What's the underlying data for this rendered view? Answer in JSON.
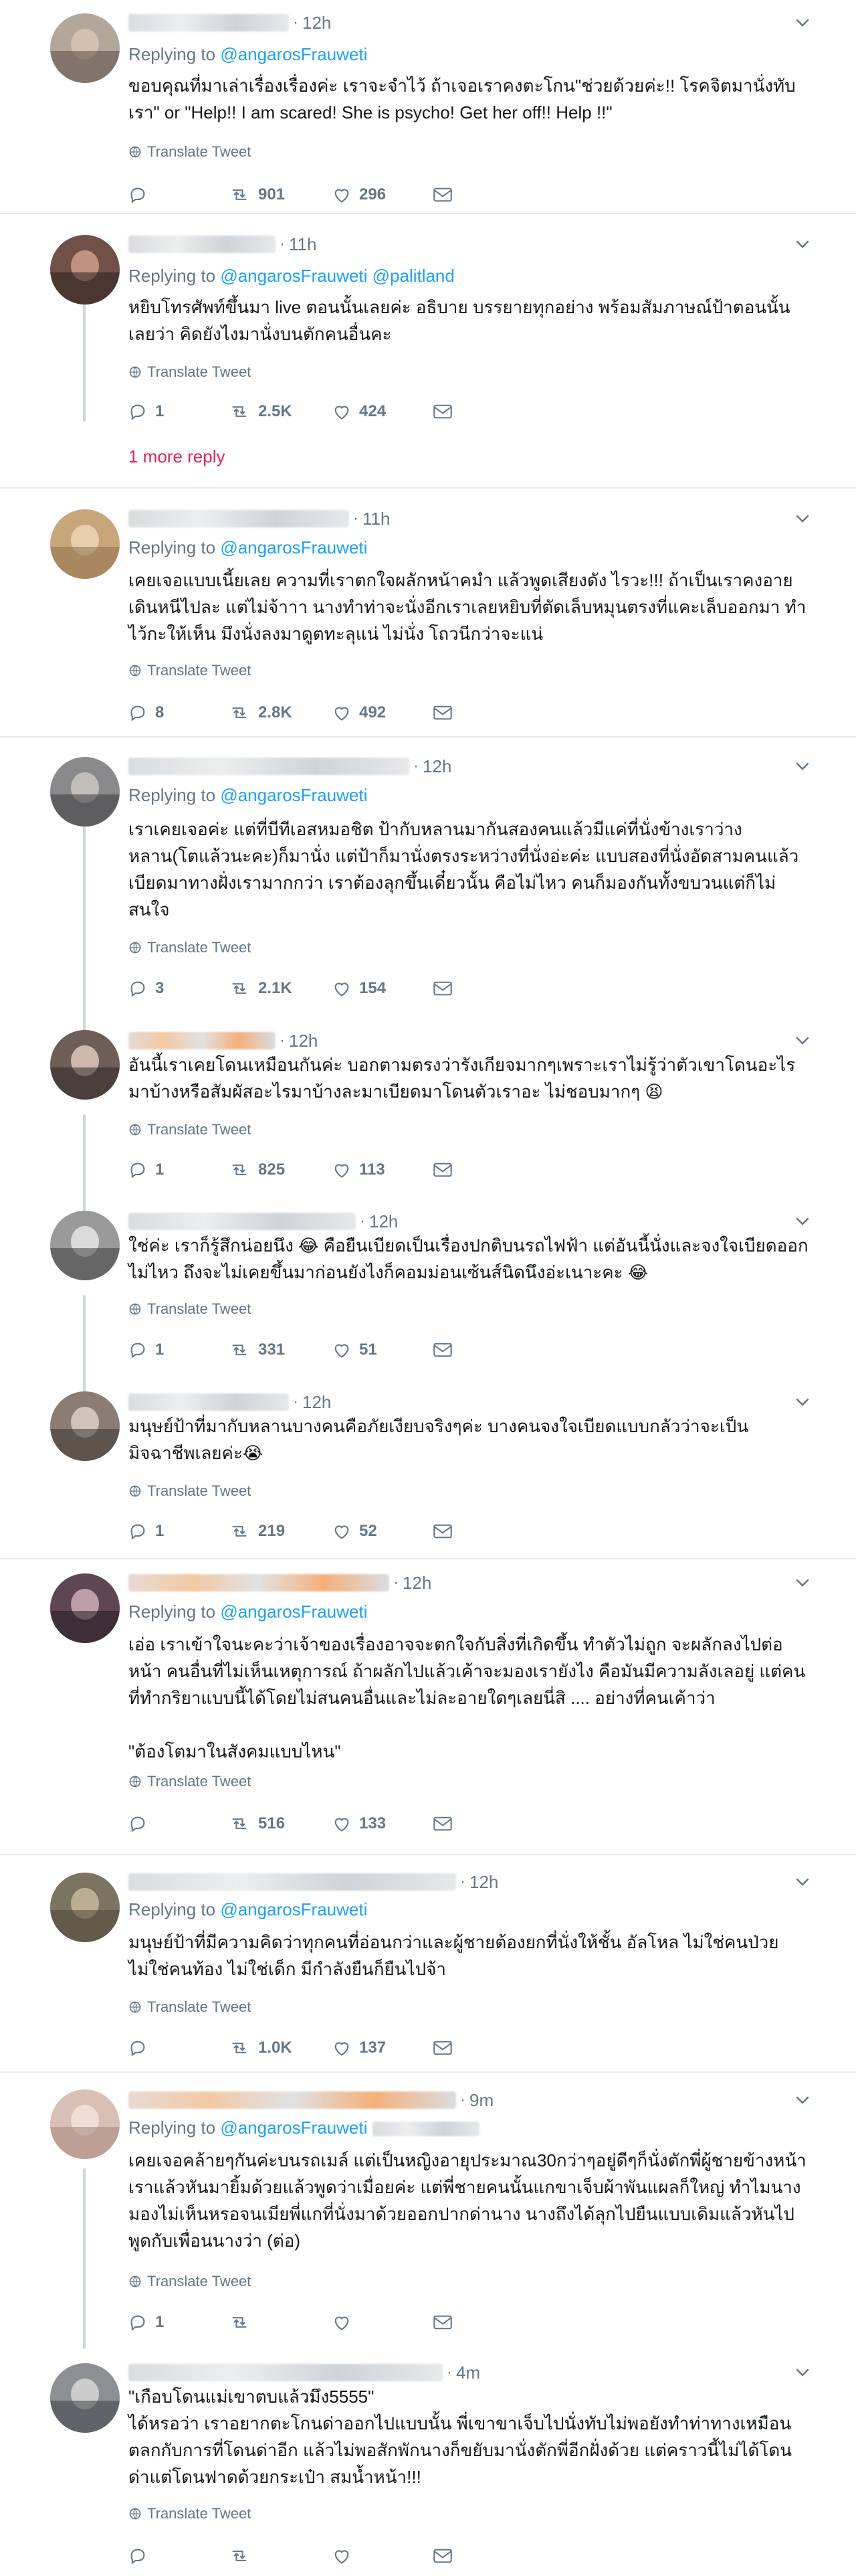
{
  "translate_label": "Translate Tweet",
  "more_replies_label": "1 more reply",
  "tweets": [
    {
      "time": "12h",
      "reply_prefix": "Replying to",
      "reply_to": "@angarosFrauweti",
      "reply_to_2": "",
      "text": "ขอบคุณที่มาเล่าเรื่องเรื่องค่ะ เราจะจำไว้ ถ้าเจอเราคงตะโกน\"ช่วยด้วยค่ะ!! โรคจิตมานั่งทับเรา\" or \"Help!! I am scared! She is psycho! Get her off!! Help !!\"",
      "replies": "",
      "retweets": "901",
      "likes": "296"
    },
    {
      "time": "11h",
      "reply_prefix": "Replying to",
      "reply_to": "@angarosFrauweti",
      "reply_to_2": "@palitland",
      "text": "หยิบโทรศัพท์ขึ้นมา live ตอนนั้นเลยค่ะ อธิบาย บรรยายทุกอย่าง พร้อมสัมภาษณ์ป้าตอนนั้นเลยว่า คิดยังไงมานั่งบนตักคนอื่นคะ",
      "replies": "1",
      "retweets": "2.5K",
      "likes": "424"
    },
    {
      "time": "11h",
      "reply_prefix": "Replying to",
      "reply_to": "@angarosFrauweti",
      "reply_to_2": "",
      "text": "เคยเจอแบบเนี้ยเลย ความที่เราตกใจผลักหน้าคมำ แล้วพูดเสียงดัง ไรวะ!!! ถ้าเป็นเราคงอายเดินหนีไปละ แต่ไม่จ้าาา นางทำท่าจะนั่งอีกเราเลยหยิบที่ตัดเล็บหมุนตรงที่แคะเล็บออกมา ทำไว้กะให้เห็น มึงนั่งลงมาดูตทะลุแน่ ไม่นั่ง โถวนีกว่าจะแน่",
      "replies": "8",
      "retweets": "2.8K",
      "likes": "492"
    },
    {
      "time": "12h",
      "reply_prefix": "Replying to",
      "reply_to": "@angarosFrauweti",
      "reply_to_2": "",
      "text": "เราเคยเจอค่ะ แต่ที่บีทีเอสหมอชิต ป้ากับหลานมากันสองคนแล้วมีแค่ที่นั่งข้างเราว่าง หลาน(โตแล้วนะคะ)ก็มานั่ง แต่ป้าก็มานั่งตรงระหว่างที่นั่งอ่ะค่ะ แบบสองที่นั่งอัดสามคนแล้วเบียดมาทางฝั่งเรามากกว่า เราต้องลุกขึ้นเดี๋ยวนั้น คือไม่ไหว คนก็มองกันทั้งขบวนแต่ก็ไม่สนใจ",
      "replies": "3",
      "retweets": "2.1K",
      "likes": "154"
    },
    {
      "time": "12h",
      "reply_prefix": "",
      "reply_to": "",
      "reply_to_2": "",
      "text": "อันนี้เราเคยโดนเหมือนกันค่ะ บอกตามตรงว่ารังเกียจมากๆเพราะเราไม่รู้ว่าตัวเขาโดนอะไรมาบ้างหรือสัมผัสอะไรมาบ้างละมาเบียดมาโดนตัวเราอะ ไม่ชอบมากๆ 😫",
      "replies": "1",
      "retweets": "825",
      "likes": "113"
    },
    {
      "time": "12h",
      "reply_prefix": "",
      "reply_to": "",
      "reply_to_2": "",
      "text": "ใช่ค่ะ เราก็รู้สึกน่อยนึง 😂 คือยืนเบียดเป็นเรื่องปกติบนรถไฟฟ้า แต่อันนี้นั่งและจงใจเบียดออก ไม่ไหว ถึงจะไม่เคยขึ้นมาก่อนยังไงก็คอมม่อนเซ้นส์นิดนึงอ่ะเนาะคะ 😂",
      "replies": "1",
      "retweets": "331",
      "likes": "51"
    },
    {
      "time": "12h",
      "reply_prefix": "",
      "reply_to": "",
      "reply_to_2": "",
      "text": "มนุษย์ป้าที่มากับหลานบางคนคือภัยเงียบจริงๆค่ะ บางคนจงใจเบียดแบบกลัวว่าจะเป็นมิจฉาชีพเลยค่ะ😭",
      "replies": "1",
      "retweets": "219",
      "likes": "52"
    },
    {
      "time": "12h",
      "reply_prefix": "Replying to",
      "reply_to": "@angarosFrauweti",
      "reply_to_2": "",
      "text": "เอ่อ เราเข้าใจนะคะว่าเจ้าของเรื่องอาจจะตกใจกับสิ่งที่เกิดขึ้น ทำตัวไม่ถูก จะผลักลงไปต่อหน้า คนอื่นที่ไม่เห็นเหตุการณ์ ถ้าผลักไปแล้วเค้าจะมองเรายังไง คือมันมีความลังเลอยู่ แต่คนที่ทำกริยาแบบนี้ได้โดยไม่สนคนอื่นและไม่ละอายใดๆเลยนี่สิ .... อย่างที่คนเค้าว่า\n\n\"ต้องโตมาในสังคมแบบไหน\"",
      "replies": "",
      "retweets": "516",
      "likes": "133"
    },
    {
      "time": "12h",
      "reply_prefix": "Replying to",
      "reply_to": "@angarosFrauweti",
      "reply_to_2": "",
      "text": "มนุษย์ป้าที่มีความคิดว่าทุกคนที่อ่อนกว่าและผู้ชายต้องยกที่นั่งให้ชั้น อัลโหล ไม่ใช่คนป่วย ไม่ใช่คนท้อง ไม่ใช่เด็ก มีกำลังยืนก็ยืนไปจ้า",
      "replies": "",
      "retweets": "1.0K",
      "likes": "137"
    },
    {
      "time": "9m",
      "reply_prefix": "Replying to",
      "reply_to": "@angarosFrauweti",
      "reply_to_2": "",
      "text": "เคยเจอคล้ายๆกันค่ะบนรถเมล์ แต่เป็นหญิงอายุประมาณ30กว่าๆอยู่ดีๆก็นั่งตักพี่ผู้ชายข้างหน้าเราแล้วหันมายิ้มด้วยแล้วพูดว่าเมื่อยค่ะ แต่พี่ชายคนนั้นแกขาเจ็บผ้าพันแผลก็ใหญ่ ทำไมนางมองไม่เห็นหรอจนเมียพี่แกที่นั่งมาด้วยออกปากด่านาง นางถึงได้ลุกไปยืนแบบเดิมแล้วหันไปพูดกับเพื่อนนางว่า (ต่อ)",
      "replies": "1",
      "retweets": "",
      "likes": ""
    },
    {
      "time": "4m",
      "reply_prefix": "",
      "reply_to": "",
      "reply_to_2": "",
      "text": "\"เกือบโดนแม่เขาตบแล้วมึง5555\"\nได้หรอว่า เราอยากตะโกนด่าออกไปแบบนั้น พี่เขาขาเจ็บไปนั่งทับไม่พอยังทำท่าทางเหมือนตลกกับการที่โดนด่าอีก แล้วไม่พอสักพักนางก็ขยับมานั่งตักพี่อีกฝั่งด้วย แต่คราวนี้ไม่ได้โดนด่าแต่โดนฟาดด้วยกระเป๋า สมน้ำหน้า!!!",
      "replies": "",
      "retweets": "",
      "likes": ""
    }
  ]
}
